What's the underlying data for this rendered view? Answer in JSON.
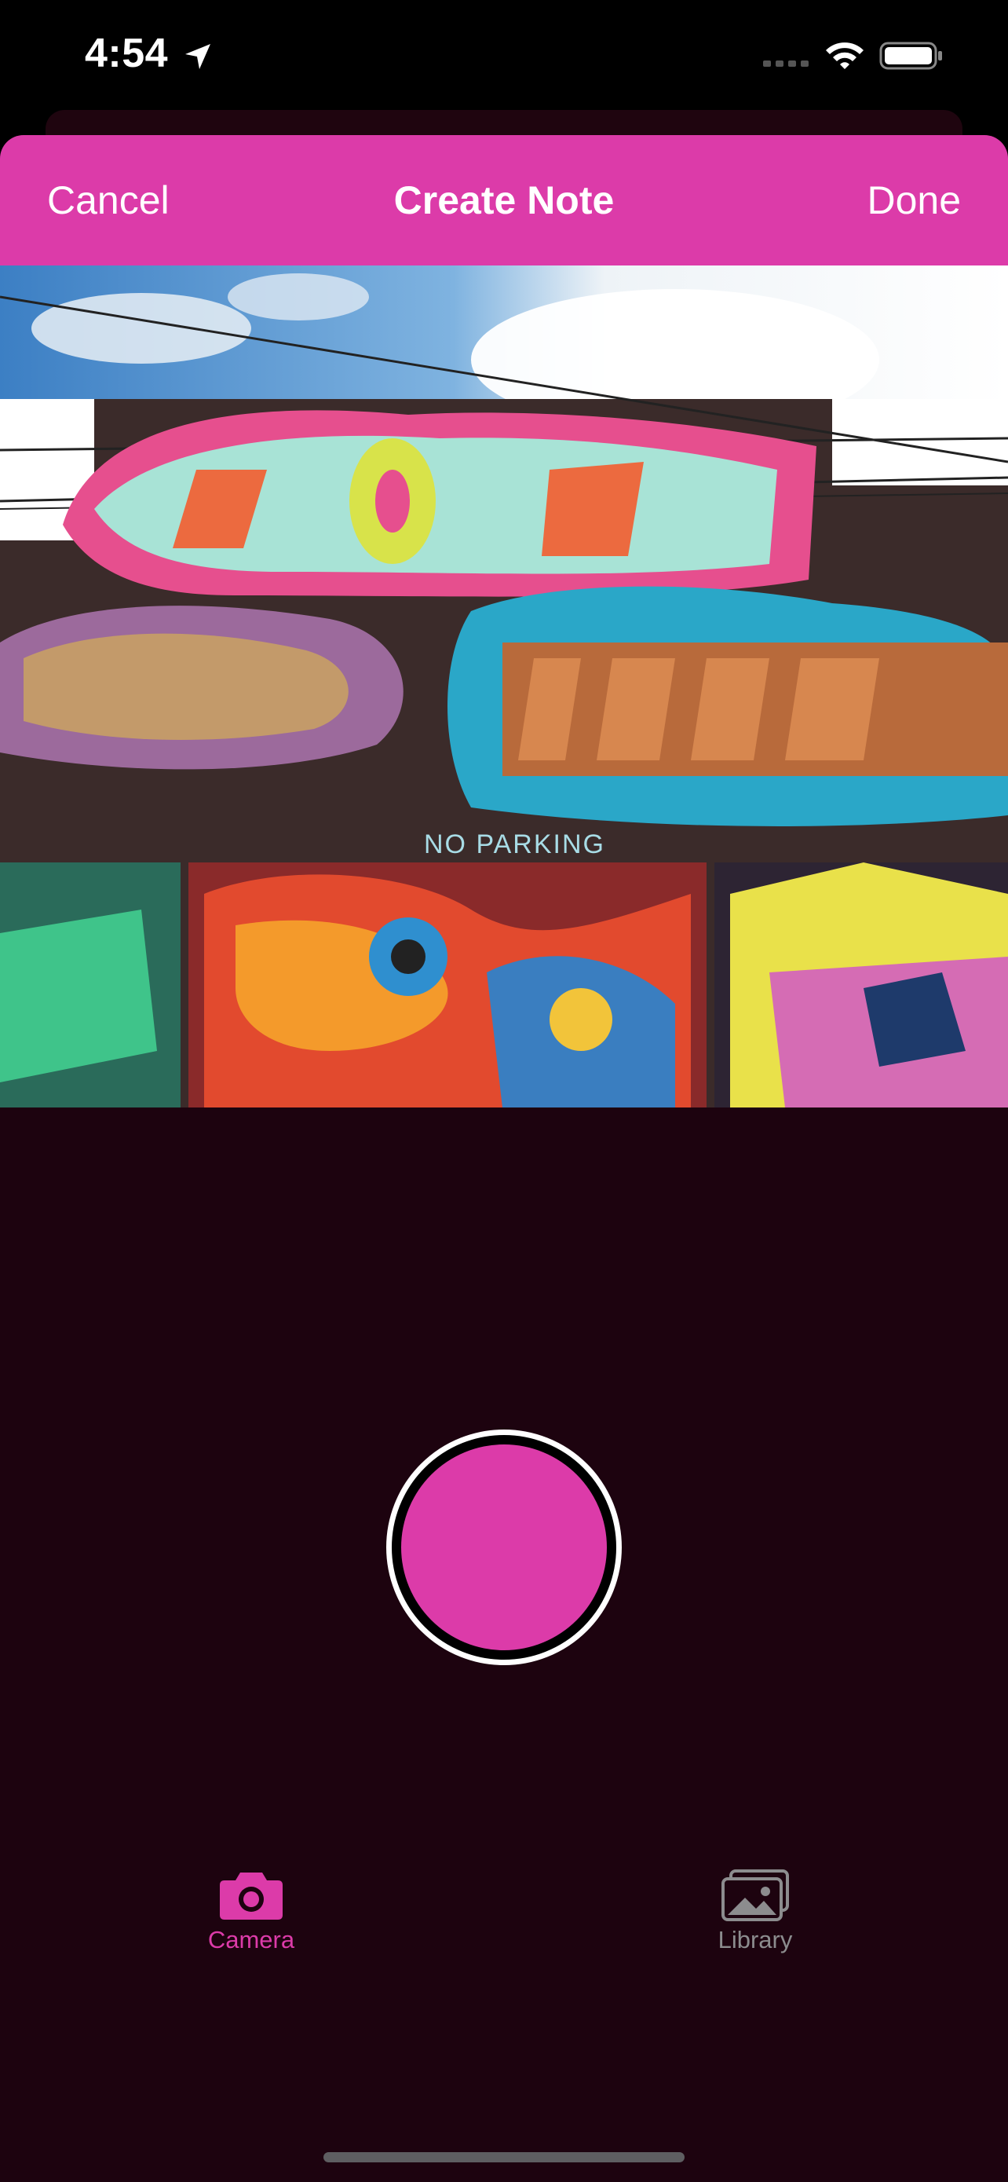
{
  "status_bar": {
    "time": "4:54",
    "icons": [
      "location-arrow-icon",
      "cellular-signal-icon",
      "wifi-icon",
      "battery-icon"
    ]
  },
  "nav": {
    "cancel_label": "Cancel",
    "title": "Create Note",
    "done_label": "Done"
  },
  "photo": {
    "sign_text": "NO PARKING"
  },
  "shutter": {
    "icon": "shutter-button"
  },
  "tabs": [
    {
      "label": "Camera",
      "icon": "camera-icon",
      "selected": true
    },
    {
      "label": "Library",
      "icon": "photo-library-icon",
      "selected": false
    }
  ],
  "colors": {
    "accent": "#dc3ba9",
    "background": "#1d030f",
    "inactive": "#8c8c8e"
  }
}
